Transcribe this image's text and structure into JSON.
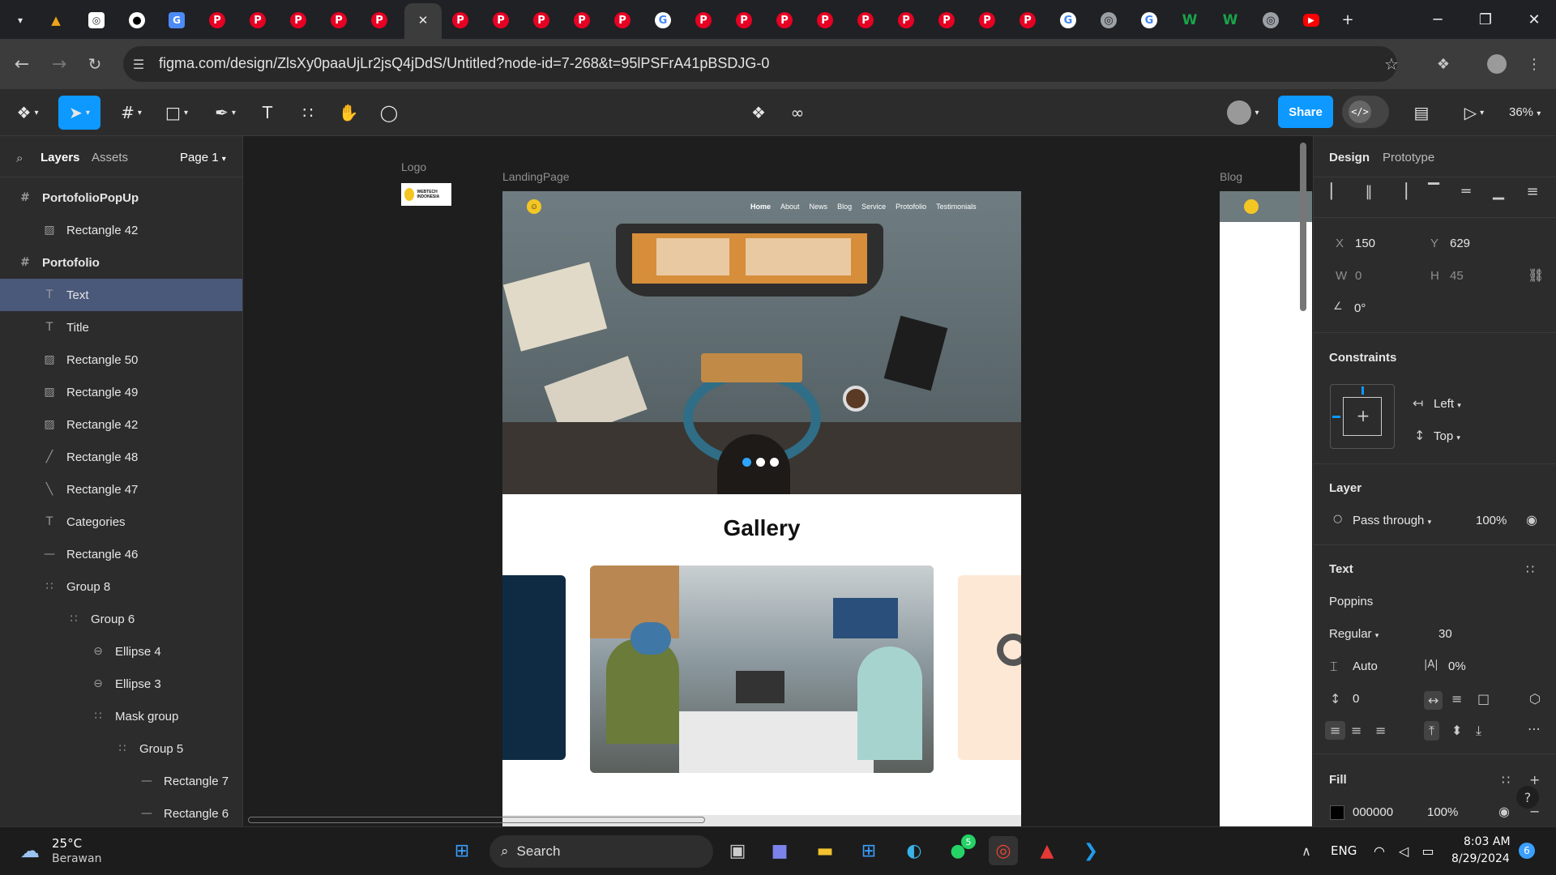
{
  "browser": {
    "tabs": [
      {
        "icon": "aa-icon",
        "glyph": "▲"
      },
      {
        "icon": "ai-icon",
        "glyph": "◎"
      },
      {
        "icon": "github-icon",
        "glyph": "●"
      },
      {
        "icon": "translate-icon",
        "glyph": "G"
      },
      {
        "icon": "pinterest-icon",
        "glyph": "P"
      },
      {
        "icon": "pinterest-icon",
        "glyph": "P"
      },
      {
        "icon": "pinterest-icon",
        "glyph": "P"
      },
      {
        "icon": "pinterest-icon",
        "glyph": "P"
      },
      {
        "icon": "pinterest-icon",
        "glyph": "P"
      },
      {
        "icon": "close-icon",
        "glyph": "✕"
      },
      {
        "icon": "pinterest-icon",
        "glyph": "P"
      },
      {
        "icon": "pinterest-icon",
        "glyph": "P"
      },
      {
        "icon": "pinterest-icon",
        "glyph": "P"
      },
      {
        "icon": "pinterest-icon",
        "glyph": "P"
      },
      {
        "icon": "pinterest-icon",
        "glyph": "P"
      },
      {
        "icon": "google-icon",
        "glyph": "G"
      },
      {
        "icon": "pinterest-icon",
        "glyph": "P"
      },
      {
        "icon": "pinterest-icon",
        "glyph": "P"
      },
      {
        "icon": "pinterest-icon",
        "glyph": "P"
      },
      {
        "icon": "pinterest-icon",
        "glyph": "P"
      },
      {
        "icon": "pinterest-icon",
        "glyph": "P"
      },
      {
        "icon": "pinterest-icon",
        "glyph": "P"
      },
      {
        "icon": "pinterest-icon",
        "glyph": "P"
      },
      {
        "icon": "pinterest-icon",
        "glyph": "P"
      },
      {
        "icon": "pinterest-icon",
        "glyph": "P"
      },
      {
        "icon": "google-icon",
        "glyph": "G"
      },
      {
        "icon": "chrome-icon",
        "glyph": "◎"
      },
      {
        "icon": "google-icon",
        "glyph": "G"
      },
      {
        "icon": "w-icon",
        "glyph": "W"
      },
      {
        "icon": "w-icon",
        "glyph": "W"
      },
      {
        "icon": "chrome-icon",
        "glyph": "◎"
      },
      {
        "icon": "youtube-icon",
        "glyph": "▶"
      }
    ],
    "url": "figma.com/design/ZlsXy0paaUjLr2jsQ4jDdS/Untitled?node-id=7-268&t=95lPSFrA41pBSDJG-0"
  },
  "figma": {
    "share_label": "Share",
    "zoom": "36%",
    "left_tabs": {
      "layers": "Layers",
      "assets": "Assets",
      "page": "Page 1"
    },
    "layers": [
      {
        "name": "PortofolioPopUp",
        "icon": "frame-icon",
        "glyph": "#",
        "indent": 0,
        "frame": true
      },
      {
        "name": "Rectangle 42",
        "icon": "image-icon",
        "glyph": "▨",
        "indent": 1
      },
      {
        "name": "Portofolio",
        "icon": "frame-icon",
        "glyph": "#",
        "indent": 0,
        "frame": true
      },
      {
        "name": "Text",
        "icon": "text-icon",
        "glyph": "T",
        "indent": 1,
        "selected": true
      },
      {
        "name": "Title",
        "icon": "text-icon",
        "glyph": "T",
        "indent": 1
      },
      {
        "name": "Rectangle 50",
        "icon": "image-icon",
        "glyph": "▨",
        "indent": 1
      },
      {
        "name": "Rectangle 49",
        "icon": "image-icon",
        "glyph": "▨",
        "indent": 1
      },
      {
        "name": "Rectangle 42",
        "icon": "image-icon",
        "glyph": "▨",
        "indent": 1
      },
      {
        "name": "Rectangle 48",
        "icon": "line-icon",
        "glyph": "╱",
        "indent": 1
      },
      {
        "name": "Rectangle 47",
        "icon": "line-icon",
        "glyph": "╲",
        "indent": 1
      },
      {
        "name": "Categories",
        "icon": "text-icon",
        "glyph": "T",
        "indent": 1
      },
      {
        "name": "Rectangle 46",
        "icon": "rect-icon",
        "glyph": "—",
        "indent": 1
      },
      {
        "name": "Group 8",
        "icon": "group-icon",
        "glyph": "∷",
        "indent": 1
      },
      {
        "name": "Group 6",
        "icon": "group-icon",
        "glyph": "∷",
        "indent": 2
      },
      {
        "name": "Ellipse 4",
        "icon": "ellipse-icon",
        "glyph": "⊖",
        "indent": 3
      },
      {
        "name": "Ellipse 3",
        "icon": "ellipse-icon",
        "glyph": "⊖",
        "indent": 3
      },
      {
        "name": "Mask group",
        "icon": "group-icon",
        "glyph": "∷",
        "indent": 3
      },
      {
        "name": "Group 5",
        "icon": "group-icon",
        "glyph": "∷",
        "indent": 4
      },
      {
        "name": "Rectangle 7",
        "icon": "rect-icon",
        "glyph": "—",
        "indent": 5
      },
      {
        "name": "Rectangle 6",
        "icon": "rect-icon",
        "glyph": "—",
        "indent": 5
      }
    ],
    "canvas": {
      "logo_label": "Logo",
      "landing_label": "LandingPage",
      "blog_label": "Blog",
      "logo_text": "WEBTECH INDONESIA",
      "nav": [
        "Home",
        "About",
        "News",
        "Blog",
        "Service",
        "Protofolio",
        "Testimonials"
      ],
      "gallery_title": "Gallery"
    },
    "right": {
      "tabs": {
        "design": "Design",
        "prototype": "Prototype"
      },
      "x_label": "X",
      "x": "150",
      "y_label": "Y",
      "y": "629",
      "w_label": "W",
      "w": "0",
      "h_label": "H",
      "h": "45",
      "rotation": "0°",
      "constraints_title": "Constraints",
      "constraint_h": "Left",
      "constraint_v": "Top",
      "layer_title": "Layer",
      "blend": "Pass through",
      "layer_opacity": "100%",
      "text_title": "Text",
      "font_family": "Poppins",
      "font_weight": "Regular",
      "font_size": "30",
      "line_height": "Auto",
      "letter_spacing": "0%",
      "paragraph_spacing": "0",
      "fill_title": "Fill",
      "fill_hex": "000000",
      "fill_opacity": "100%"
    }
  },
  "taskbar": {
    "temp": "25°C",
    "weather": "Berawan",
    "search": "Search",
    "lang": "ENG",
    "time": "8:03 AM",
    "date": "8/29/2024",
    "whatsapp_badge": "5",
    "notif_count": "6"
  },
  "colors": {
    "accent": "#0d99ff",
    "selection": "#4a5879",
    "pinterest": "#e60023"
  }
}
